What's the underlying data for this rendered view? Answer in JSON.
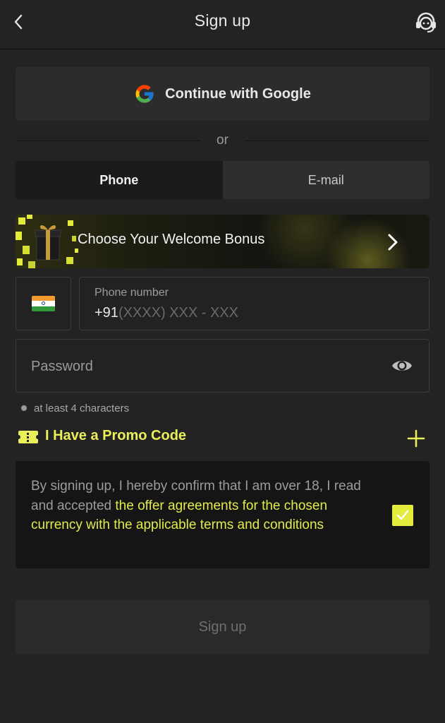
{
  "header": {
    "title": "Sign up",
    "back_icon": "chevron-left-icon",
    "support_icon": "headset-support-icon"
  },
  "google": {
    "label": "Continue with Google",
    "icon": "google-g-icon"
  },
  "divider": {
    "text": "or"
  },
  "tabs": [
    {
      "label": "Phone",
      "active": true
    },
    {
      "label": "E-mail",
      "active": false
    }
  ],
  "bonus": {
    "label": "Choose Your Welcome Bonus",
    "icon": "gift-icon"
  },
  "phone": {
    "country_flag": "india-flag-icon",
    "label": "Phone number",
    "prefix": "+91",
    "mask": "(XXXX) XXX - XXX"
  },
  "password": {
    "placeholder": "Password",
    "hint": "at least 4 characters"
  },
  "promo": {
    "label": "I Have a Promo Code"
  },
  "agreement": {
    "text_plain": "By signing up, I hereby confirm that I am over 18, I read and accepted ",
    "text_link": "the offer agreements for the chosen currency with the applicable terms and conditions",
    "checked": true
  },
  "submit": {
    "label": "Sign up"
  },
  "colors": {
    "accent": "#e3ec3c",
    "background": "#232323",
    "panel": "#2c2c2c"
  }
}
